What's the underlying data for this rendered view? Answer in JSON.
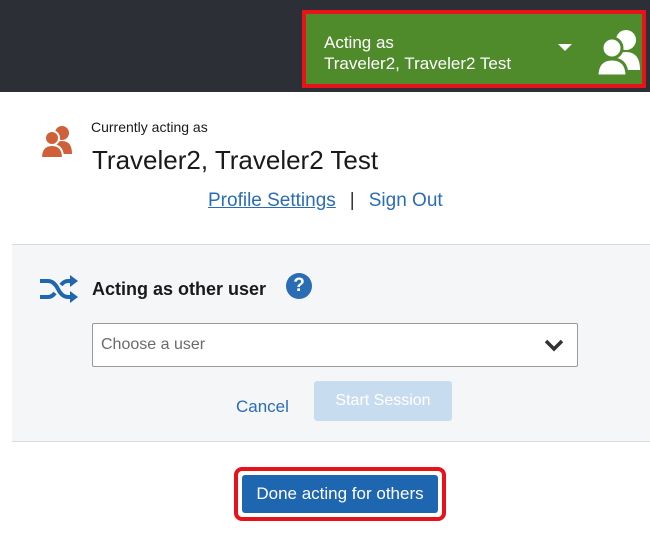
{
  "header": {
    "acting_line1": "Acting as",
    "acting_line2": "Traveler2, Traveler2 Test",
    "icon": "users-icon"
  },
  "current_user": {
    "label": "Currently acting as",
    "name": "Traveler2, Traveler2 Test",
    "profile_link": "Profile Settings",
    "separator": "|",
    "signout_link": "Sign Out",
    "icon": "users-icon"
  },
  "other_user": {
    "title": "Acting as other user",
    "help": "?",
    "icon": "shuffle-icon",
    "select_placeholder": "Choose a user",
    "cancel": "Cancel",
    "start": "Start Session"
  },
  "footer": {
    "done_button": "Done acting for others"
  },
  "colors": {
    "topbar": "#2c3036",
    "acting_green": "#4f8a2b",
    "highlight_red": "#e8121a",
    "link_blue": "#2a6db5",
    "icon_orange": "#d0603a",
    "button_blue": "#1f66b0"
  }
}
